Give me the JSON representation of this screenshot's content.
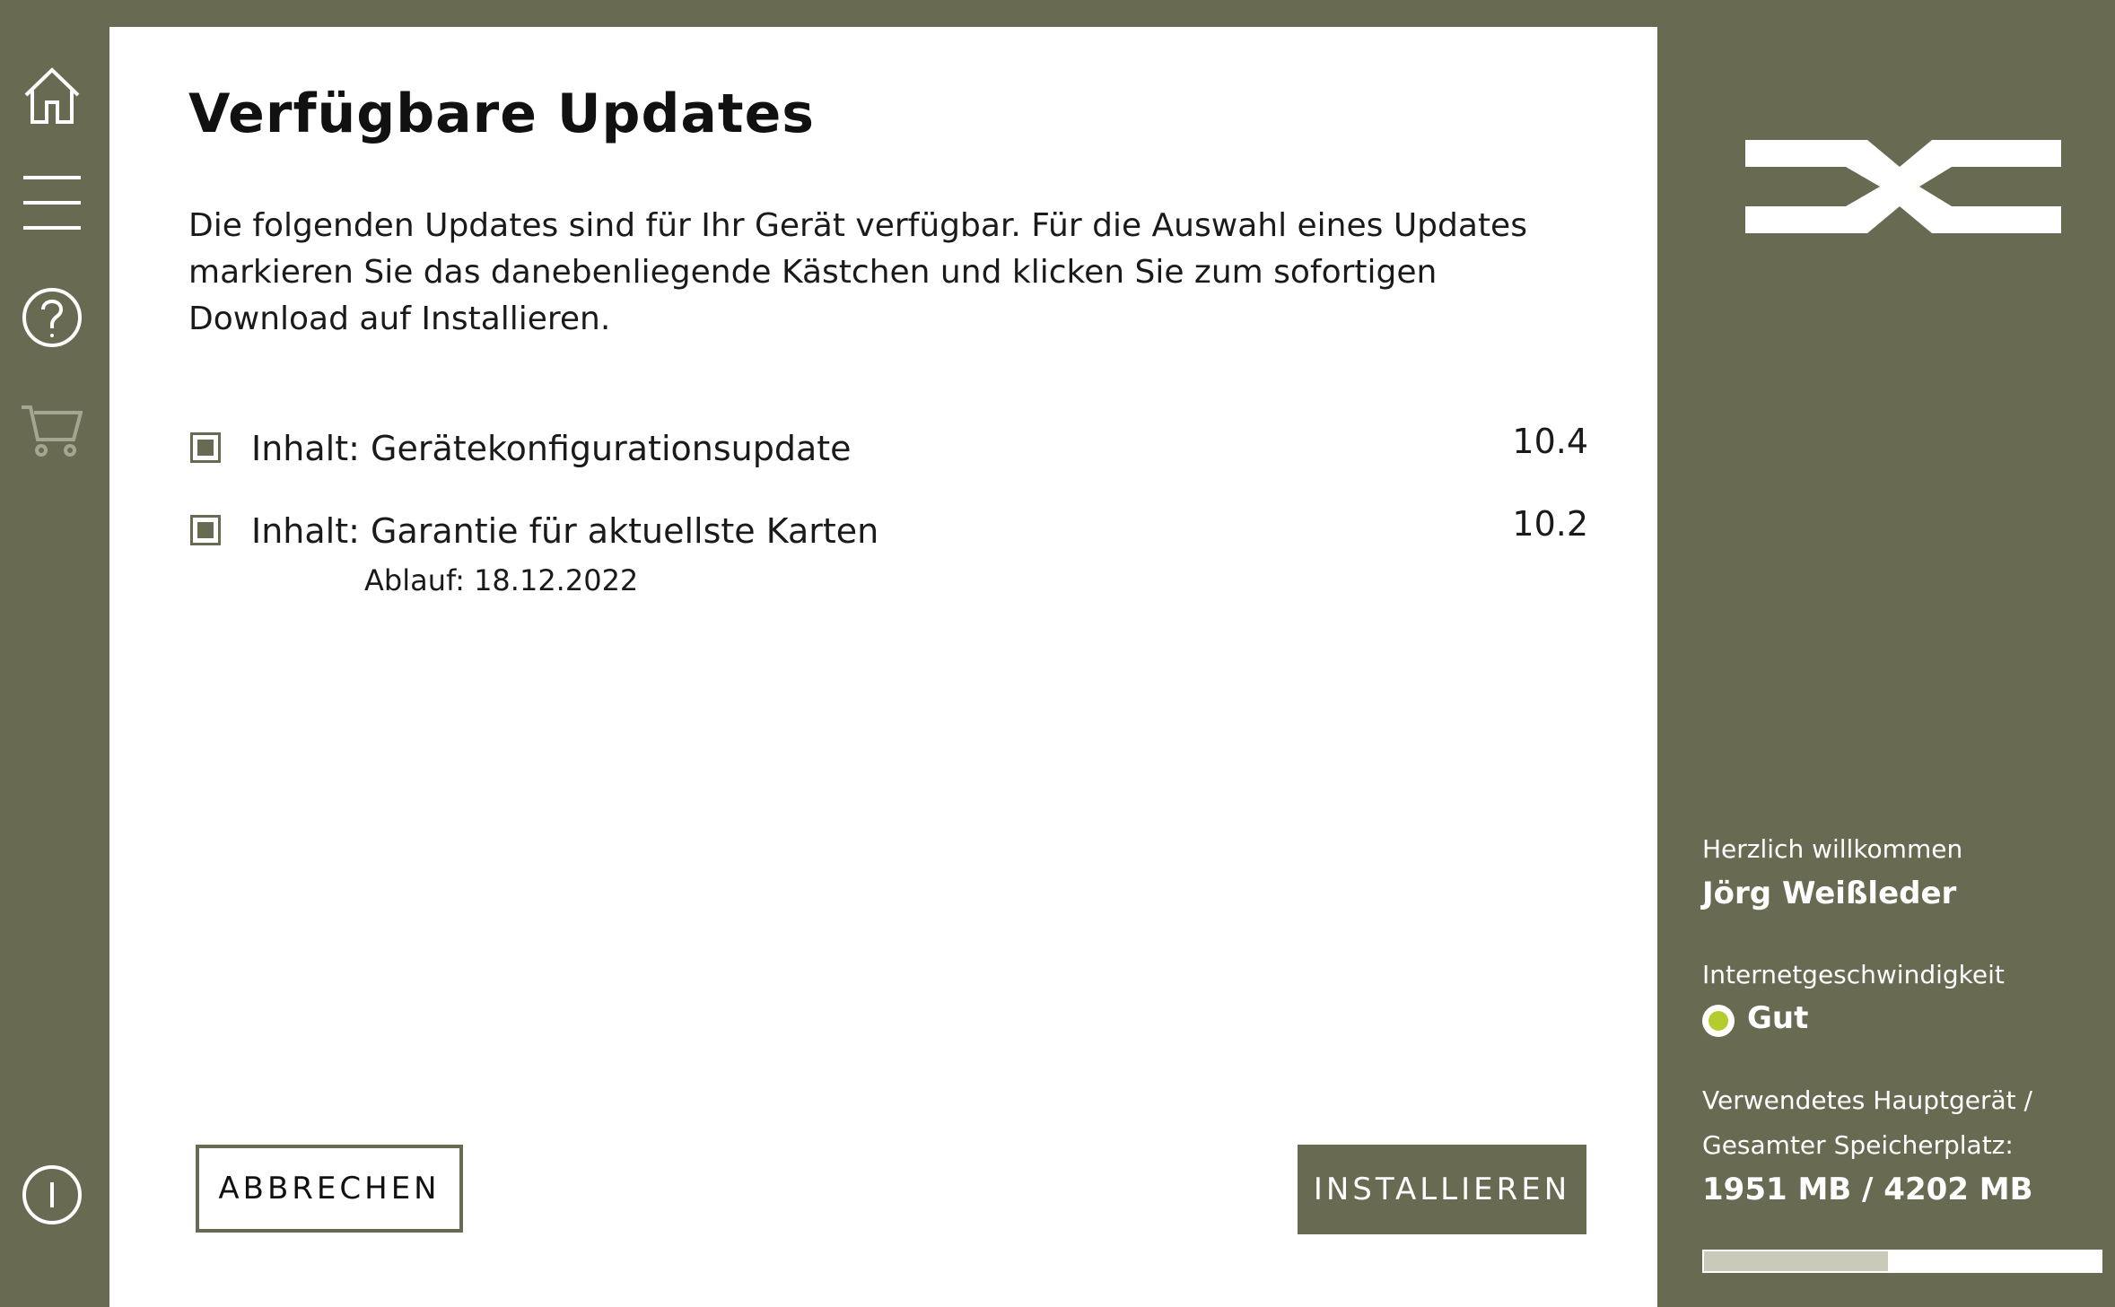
{
  "sidebar": {
    "icons": [
      {
        "name": "home-icon"
      },
      {
        "name": "menu-icon"
      },
      {
        "name": "help-icon"
      },
      {
        "name": "cart-icon"
      },
      {
        "name": "info-icon"
      }
    ]
  },
  "main": {
    "title": "Verfügbare Updates",
    "description": "Die folgenden Updates sind für Ihr Gerät verfügbar. Für die Auswahl eines Updates markieren Sie das danebenliegende Kästchen und klicken Sie zum sofortigen Download auf Installieren.",
    "updates": [
      {
        "label": "Inhalt: Gerätekonfigurationsupdate",
        "version": "10.4",
        "checked": true,
        "expiry": ""
      },
      {
        "label": "Inhalt: Garantie für aktuellste Karten",
        "version": "10.2",
        "checked": true,
        "expiry": "Ablauf: 18.12.2022"
      }
    ],
    "cancel_label": "ABBRECHEN",
    "install_label": "INSTALLIEREN"
  },
  "account": {
    "welcome_label": "Herzlich willkommen",
    "user_name": "Jörg Weißleder",
    "speed_label": "Internetgeschwindigkeit",
    "speed_value": "Gut",
    "storage_label_line1": "Verwendetes Hauptgerät /",
    "storage_label_line2": "Gesamter Speicherplatz:",
    "storage_value": "1951 MB / 4202 MB",
    "storage_used_fraction": 0.464
  },
  "colors": {
    "brand": "#686b52",
    "speed_good": "#b5cc2e",
    "storage_fill": "#c9cab9"
  }
}
